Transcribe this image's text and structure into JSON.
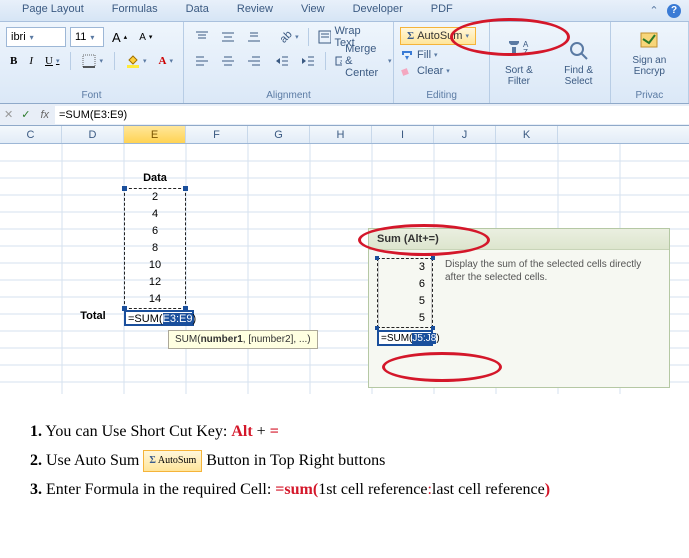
{
  "tabs": [
    "Page Layout",
    "Formulas",
    "Data",
    "Review",
    "View",
    "Developer",
    "PDF"
  ],
  "font": {
    "name_fragment": "ibri",
    "size": "11",
    "bold": "B",
    "italic": "I",
    "underline": "U",
    "grow": "A",
    "shrink": "A",
    "label": "Font"
  },
  "alignment": {
    "wrap": "Wrap Text",
    "merge": "Merge & Center",
    "label": "Alignment"
  },
  "editing": {
    "autosum": "AutoSum",
    "fill": "Fill",
    "clear": "Clear",
    "label": "Editing"
  },
  "sortfind": {
    "sort": "Sort & Filter",
    "find": "Find & Select"
  },
  "sign": {
    "sign": "Sign an Encryp",
    "privacy": "Privac"
  },
  "formula_bar": "=SUM(E3:E9)",
  "fb_icons": {
    "cancel": "✕",
    "enter": "✓",
    "fx": "fx"
  },
  "columns": [
    "C",
    "D",
    "E",
    "F",
    "G",
    "H",
    "I",
    "J",
    "K"
  ],
  "selected_col": "E",
  "data_header": "Data",
  "data_values": [
    "2",
    "4",
    "6",
    "8",
    "10",
    "12",
    "14"
  ],
  "total_label": "Total",
  "sum_formula_pre": "=SUM(",
  "sum_formula_sel": "E3:E9",
  "sum_formula_post": ")",
  "func_tip": {
    "pre": "SUM(",
    "b": "number1",
    "post": ", [number2], ...)"
  },
  "tip_panel": {
    "title": "Sum (Alt+=)",
    "text": "Display the sum of the selected cells directly after the selected cells.",
    "vals": [
      "3",
      "6",
      "5",
      "5"
    ],
    "sum_pre": "=SUM(",
    "sum_sel": "J5:J8",
    "sum_post": ")"
  },
  "instructions": {
    "l1a": "1.",
    "l1b": " You can Use Short Cut Key:   ",
    "l1c": "Alt",
    "l1d": " + ",
    "l1e": "=",
    "l2a": "2.",
    "l2b": " Use Auto Sum ",
    "l2c": "AutoSum",
    "l2d": " Button in Top Right buttons",
    "l3a": "3.",
    "l3b": " Enter Formula in the required Cell:  ",
    "l3c": "=sum(",
    "l3d": "1st cell reference",
    "l3e": ":",
    "l3f": "last cell reference",
    "l3g": ")"
  }
}
